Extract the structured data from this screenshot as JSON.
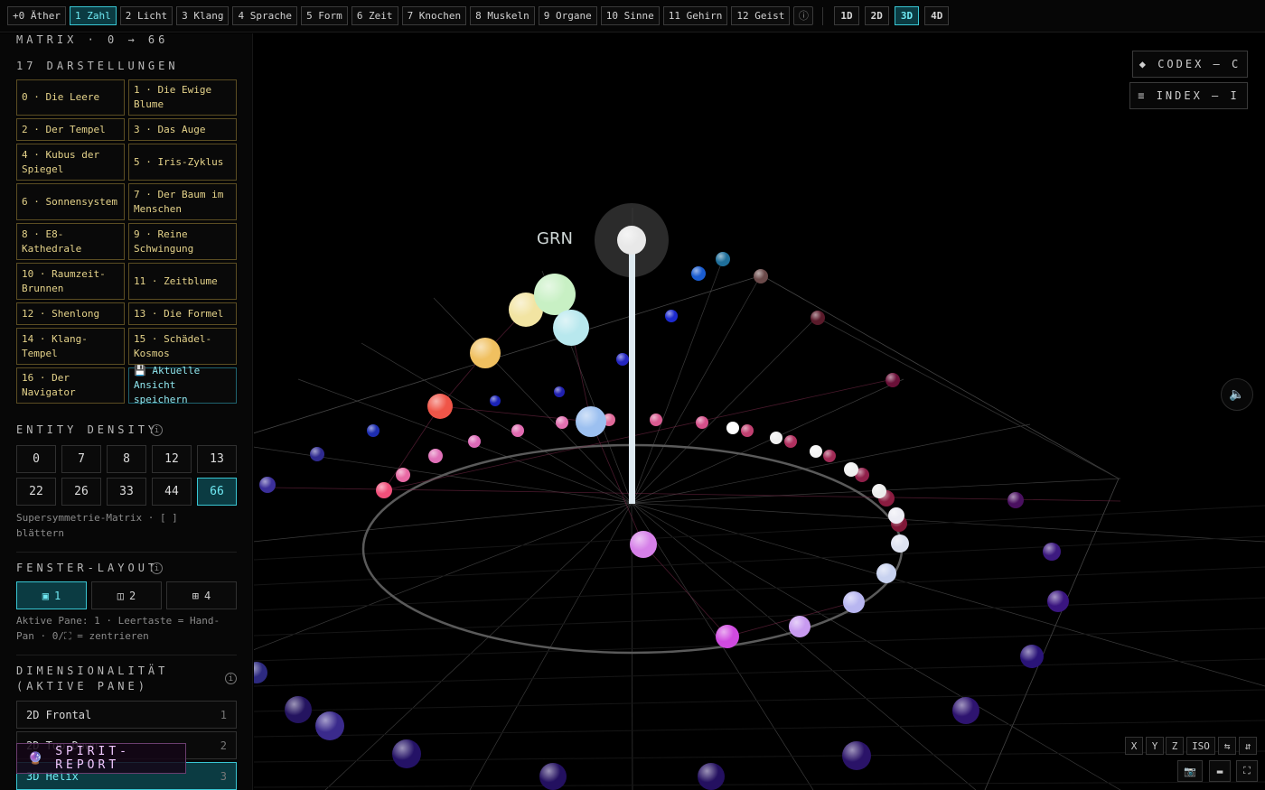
{
  "topbar": {
    "tabs": [
      "+0 Äther",
      "1 Zahl",
      "2 Licht",
      "3 Klang",
      "4 Sprache",
      "5 Form",
      "6 Zeit",
      "7 Knochen",
      "8 Muskeln",
      "9 Organe",
      "10 Sinne",
      "11 Gehirn",
      "12 Geist"
    ],
    "active_tab": "1 Zahl",
    "info_glyph": "ⓘ",
    "dims": [
      "1D",
      "2D",
      "3D",
      "4D"
    ],
    "active_dim": "3D"
  },
  "sidebar": {
    "matrix_title": "MATRIX · 0 → 66",
    "presets_title": "17 DARSTELLUNGEN",
    "presets": [
      "0 · Die Leere",
      "1 · Die Ewige Blume",
      "2 · Der Tempel",
      "3 · Das Auge",
      "4 · Kubus der Spiegel",
      "5 · Iris-Zyklus",
      "6 · Sonnensystem",
      "7 · Der Baum im Menschen",
      "8 · E8-Kathedrale",
      "9 · Reine Schwingung",
      "10 · Raumzeit-Brunnen",
      "11 · Zeitblume",
      "12 · Shenlong",
      "13 · Die Formel",
      "14 · Klang-Tempel",
      "15 · Schädel-Kosmos",
      "16 · Der Navigator",
      "💾 Aktuelle Ansicht speichern"
    ],
    "density_title": "ENTITY DENSITY",
    "density_values": [
      "0",
      "7",
      "8",
      "12",
      "13",
      "22",
      "26",
      "33",
      "44",
      "66"
    ],
    "density_active": "66",
    "density_note": "Supersymmetrie-Matrix · [ ] blättern",
    "layout_title": "FENSTER-LAYOUT",
    "layouts": [
      {
        "icon": "▣",
        "label": "1"
      },
      {
        "icon": "◫",
        "label": "2"
      },
      {
        "icon": "⊞",
        "label": "4"
      }
    ],
    "layout_active": "1",
    "layout_note": "Aktive Pane: 1 · Leertaste = Hand-Pan · 0/⛶ = zentrieren",
    "dim_title_1": "DIMENSIONALITÄT",
    "dim_title_2": "(AKTIVE PANE)",
    "dim_modes": [
      {
        "label": "2D Frontal",
        "key": "1"
      },
      {
        "label": "2D Top-Down",
        "key": "2"
      },
      {
        "label": "3D Helix",
        "key": "3"
      }
    ],
    "dim_active": "3D Helix",
    "spirit_label": "SPIRIT-REPORT",
    "spirit_icon": "🔮"
  },
  "scene": {
    "codex_label": "◆ CODEX — C",
    "index_label": "≡ INDEX — I",
    "node_label": "GRN",
    "mute_icon": "🔈",
    "axis_buttons": [
      "X",
      "Y",
      "Z",
      "ISO",
      "⇆",
      "⇵"
    ],
    "tool_buttons": [
      "📷",
      "▬",
      "⛶"
    ]
  }
}
